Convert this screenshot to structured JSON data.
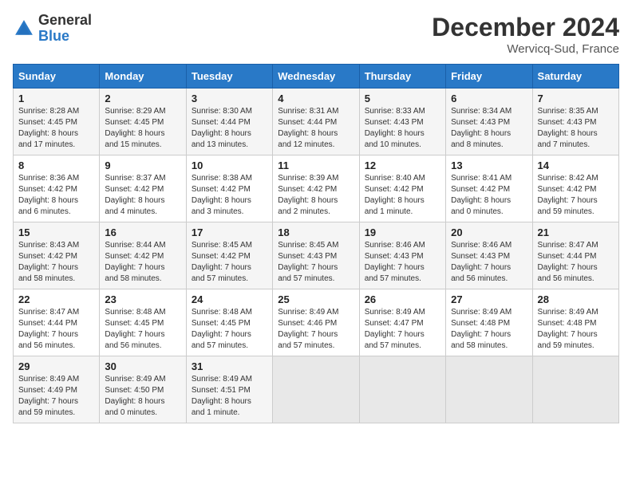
{
  "header": {
    "logo_line1": "General",
    "logo_line2": "Blue",
    "title": "December 2024",
    "subtitle": "Wervicq-Sud, France"
  },
  "calendar": {
    "headers": [
      "Sunday",
      "Monday",
      "Tuesday",
      "Wednesday",
      "Thursday",
      "Friday",
      "Saturday"
    ],
    "weeks": [
      [
        {
          "day": "",
          "info": ""
        },
        {
          "day": "2",
          "info": "Sunrise: 8:29 AM\nSunset: 4:45 PM\nDaylight: 8 hours\nand 15 minutes."
        },
        {
          "day": "3",
          "info": "Sunrise: 8:30 AM\nSunset: 4:44 PM\nDaylight: 8 hours\nand 13 minutes."
        },
        {
          "day": "4",
          "info": "Sunrise: 8:31 AM\nSunset: 4:44 PM\nDaylight: 8 hours\nand 12 minutes."
        },
        {
          "day": "5",
          "info": "Sunrise: 8:33 AM\nSunset: 4:43 PM\nDaylight: 8 hours\nand 10 minutes."
        },
        {
          "day": "6",
          "info": "Sunrise: 8:34 AM\nSunset: 4:43 PM\nDaylight: 8 hours\nand 8 minutes."
        },
        {
          "day": "7",
          "info": "Sunrise: 8:35 AM\nSunset: 4:43 PM\nDaylight: 8 hours\nand 7 minutes."
        }
      ],
      [
        {
          "day": "8",
          "info": "Sunrise: 8:36 AM\nSunset: 4:42 PM\nDaylight: 8 hours\nand 6 minutes."
        },
        {
          "day": "9",
          "info": "Sunrise: 8:37 AM\nSunset: 4:42 PM\nDaylight: 8 hours\nand 4 minutes."
        },
        {
          "day": "10",
          "info": "Sunrise: 8:38 AM\nSunset: 4:42 PM\nDaylight: 8 hours\nand 3 minutes."
        },
        {
          "day": "11",
          "info": "Sunrise: 8:39 AM\nSunset: 4:42 PM\nDaylight: 8 hours\nand 2 minutes."
        },
        {
          "day": "12",
          "info": "Sunrise: 8:40 AM\nSunset: 4:42 PM\nDaylight: 8 hours\nand 1 minute."
        },
        {
          "day": "13",
          "info": "Sunrise: 8:41 AM\nSunset: 4:42 PM\nDaylight: 8 hours\nand 0 minutes."
        },
        {
          "day": "14",
          "info": "Sunrise: 8:42 AM\nSunset: 4:42 PM\nDaylight: 7 hours\nand 59 minutes."
        }
      ],
      [
        {
          "day": "15",
          "info": "Sunrise: 8:43 AM\nSunset: 4:42 PM\nDaylight: 7 hours\nand 58 minutes."
        },
        {
          "day": "16",
          "info": "Sunrise: 8:44 AM\nSunset: 4:42 PM\nDaylight: 7 hours\nand 58 minutes."
        },
        {
          "day": "17",
          "info": "Sunrise: 8:45 AM\nSunset: 4:42 PM\nDaylight: 7 hours\nand 57 minutes."
        },
        {
          "day": "18",
          "info": "Sunrise: 8:45 AM\nSunset: 4:43 PM\nDaylight: 7 hours\nand 57 minutes."
        },
        {
          "day": "19",
          "info": "Sunrise: 8:46 AM\nSunset: 4:43 PM\nDaylight: 7 hours\nand 57 minutes."
        },
        {
          "day": "20",
          "info": "Sunrise: 8:46 AM\nSunset: 4:43 PM\nDaylight: 7 hours\nand 56 minutes."
        },
        {
          "day": "21",
          "info": "Sunrise: 8:47 AM\nSunset: 4:44 PM\nDaylight: 7 hours\nand 56 minutes."
        }
      ],
      [
        {
          "day": "22",
          "info": "Sunrise: 8:47 AM\nSunset: 4:44 PM\nDaylight: 7 hours\nand 56 minutes."
        },
        {
          "day": "23",
          "info": "Sunrise: 8:48 AM\nSunset: 4:45 PM\nDaylight: 7 hours\nand 56 minutes."
        },
        {
          "day": "24",
          "info": "Sunrise: 8:48 AM\nSunset: 4:45 PM\nDaylight: 7 hours\nand 57 minutes."
        },
        {
          "day": "25",
          "info": "Sunrise: 8:49 AM\nSunset: 4:46 PM\nDaylight: 7 hours\nand 57 minutes."
        },
        {
          "day": "26",
          "info": "Sunrise: 8:49 AM\nSunset: 4:47 PM\nDaylight: 7 hours\nand 57 minutes."
        },
        {
          "day": "27",
          "info": "Sunrise: 8:49 AM\nSunset: 4:48 PM\nDaylight: 7 hours\nand 58 minutes."
        },
        {
          "day": "28",
          "info": "Sunrise: 8:49 AM\nSunset: 4:48 PM\nDaylight: 7 hours\nand 59 minutes."
        }
      ],
      [
        {
          "day": "29",
          "info": "Sunrise: 8:49 AM\nSunset: 4:49 PM\nDaylight: 7 hours\nand 59 minutes."
        },
        {
          "day": "30",
          "info": "Sunrise: 8:49 AM\nSunset: 4:50 PM\nDaylight: 8 hours\nand 0 minutes."
        },
        {
          "day": "31",
          "info": "Sunrise: 8:49 AM\nSunset: 4:51 PM\nDaylight: 8 hours\nand 1 minute."
        },
        {
          "day": "",
          "info": ""
        },
        {
          "day": "",
          "info": ""
        },
        {
          "day": "",
          "info": ""
        },
        {
          "day": "",
          "info": ""
        }
      ]
    ],
    "first_week_first_day": {
      "day": "1",
      "info": "Sunrise: 8:28 AM\nSunset: 4:45 PM\nDaylight: 8 hours\nand 17 minutes."
    }
  }
}
